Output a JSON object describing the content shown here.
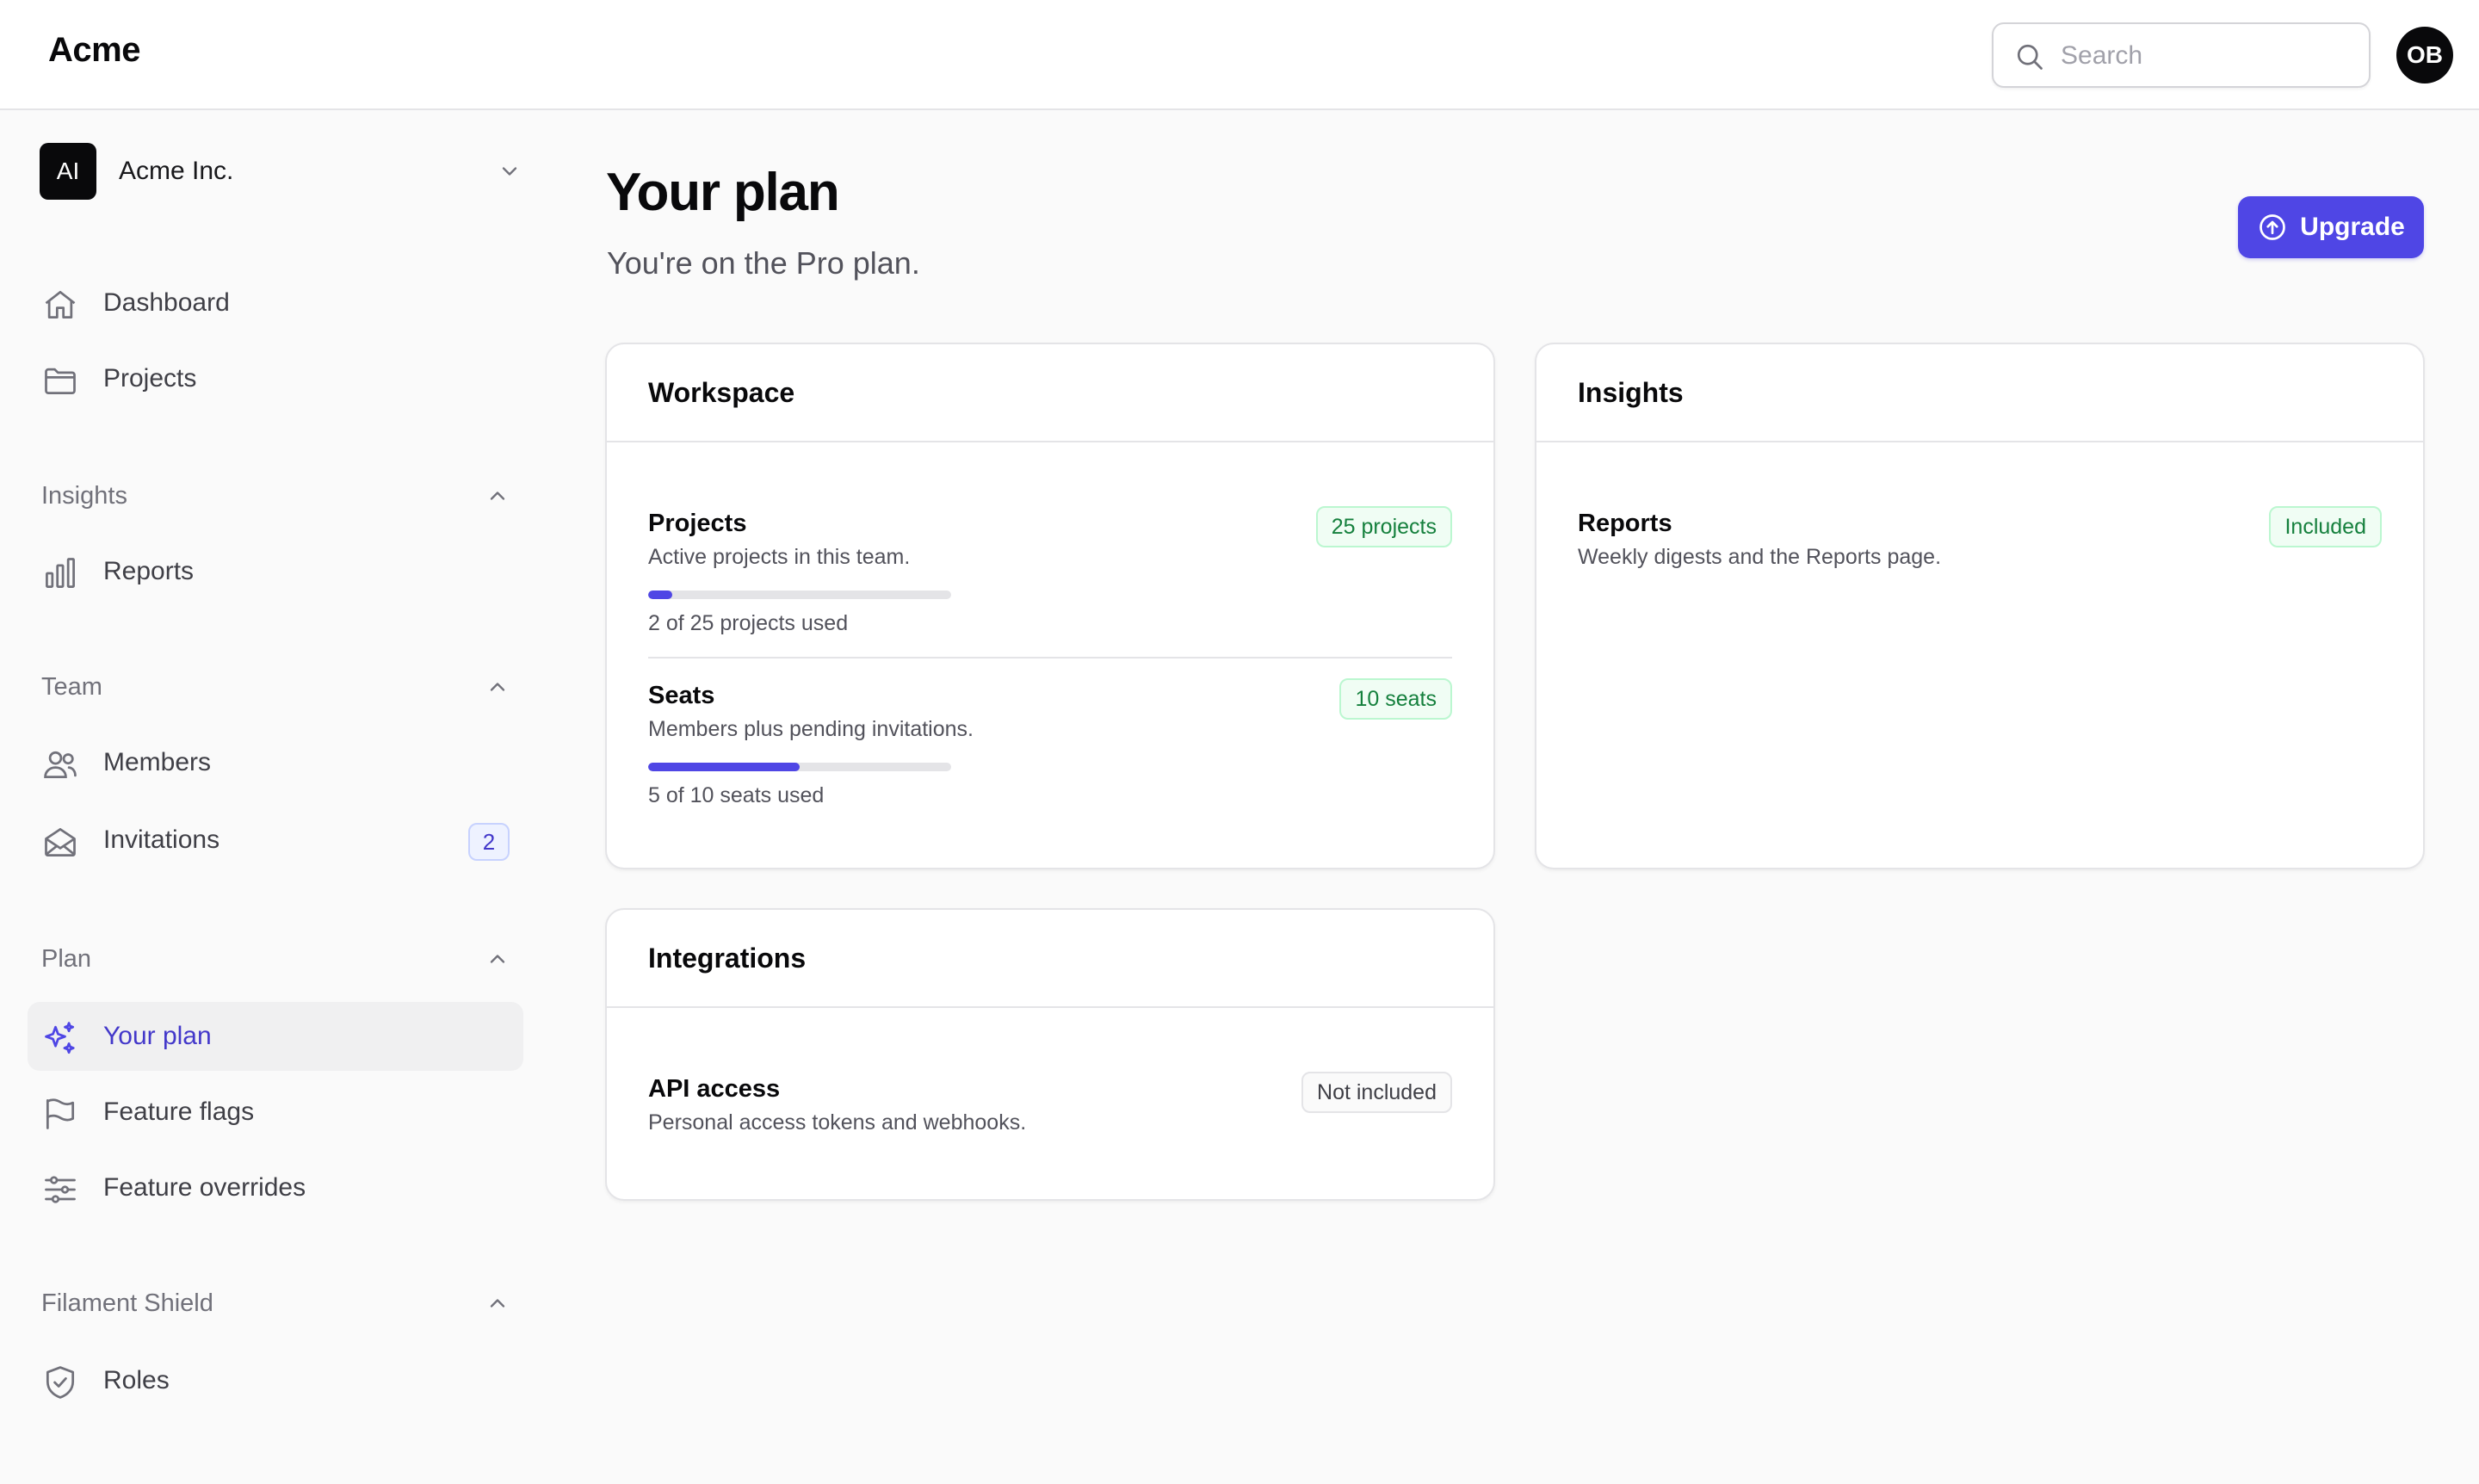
{
  "topbar": {
    "brand": "Acme",
    "search_placeholder": "Search",
    "avatar_initials": "OB"
  },
  "sidebar": {
    "tenant": {
      "initials": "AI",
      "name": "Acme Inc."
    },
    "items": [
      {
        "label": "Dashboard",
        "icon": "home-icon"
      },
      {
        "label": "Projects",
        "icon": "folder-icon"
      }
    ],
    "groups": [
      {
        "label": "Insights",
        "items": [
          {
            "label": "Reports",
            "icon": "bar-chart-icon"
          }
        ]
      },
      {
        "label": "Team",
        "items": [
          {
            "label": "Members",
            "icon": "users-icon"
          },
          {
            "label": "Invitations",
            "icon": "envelope-icon",
            "badge": "2"
          }
        ]
      },
      {
        "label": "Plan",
        "items": [
          {
            "label": "Your plan",
            "icon": "sparkles-icon",
            "active": true
          },
          {
            "label": "Feature flags",
            "icon": "flag-icon"
          },
          {
            "label": "Feature overrides",
            "icon": "sliders-icon"
          }
        ]
      },
      {
        "label": "Filament Shield",
        "items": [
          {
            "label": "Roles",
            "icon": "shield-check-icon"
          }
        ]
      }
    ]
  },
  "main": {
    "title": "Your plan",
    "subtitle": "You're on the Pro plan.",
    "upgrade_label": "Upgrade",
    "cards": {
      "workspace": {
        "title": "Workspace",
        "rows": [
          {
            "title": "Projects",
            "description": "Active projects in this team.",
            "badge": "25 projects",
            "usage": "2 of 25 projects used",
            "used_fraction": 0.08
          },
          {
            "title": "Seats",
            "description": "Members plus pending invitations.",
            "badge": "10 seats",
            "usage": "5 of 10 seats used",
            "used_fraction": 0.5
          }
        ]
      },
      "insights": {
        "title": "Insights",
        "rows": [
          {
            "title": "Reports",
            "description": "Weekly digests and the Reports page.",
            "badge": "Included"
          }
        ]
      },
      "integrations": {
        "title": "Integrations",
        "rows": [
          {
            "title": "API access",
            "description": "Personal access tokens and webhooks.",
            "badge": "Not included"
          }
        ]
      }
    }
  },
  "colors": {
    "accent": "#4f46e5",
    "accent_text": "#4338ca",
    "included_green": "#15803d"
  }
}
